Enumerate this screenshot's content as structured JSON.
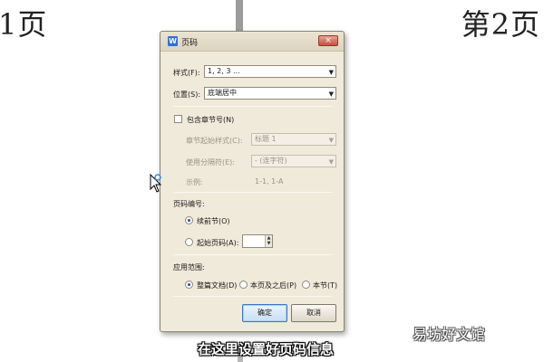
{
  "background": {
    "page_left": "1页",
    "page_right": "第2页"
  },
  "dialog": {
    "title": "页码",
    "title_icon": "W",
    "close": "×",
    "style": {
      "label": "样式(F):",
      "value": "1, 2, 3 ..."
    },
    "position": {
      "label": "位置(S):",
      "value": "底端居中"
    },
    "chapter": {
      "label": "包含章节号(N)",
      "checked": false
    },
    "chapter_style": {
      "label": "章节起始样式(C):",
      "value": "标题 1"
    },
    "separator": {
      "label": "使用分隔符(E):",
      "value": "-    (连字符)"
    },
    "example": {
      "label": "示例:",
      "value": "1-1, 1-A"
    },
    "numbering": {
      "group_label": "页码编号:",
      "continue": "续前节(O)",
      "start_at": "起始页码(A):",
      "selected": "continue"
    },
    "scope": {
      "group_label": "应用范围:",
      "whole": "整篇文档(D)",
      "after": "本页及之后(P)",
      "section": "本节(T)",
      "selected": "whole"
    },
    "ok": "确定",
    "cancel": "取消"
  },
  "overlay": {
    "subtitle": "在这里设置好页码信息",
    "watermark": "易坊好文馆"
  },
  "colors": {
    "dialog_bg": "#f0eadb",
    "accent": "#3a78c8"
  }
}
